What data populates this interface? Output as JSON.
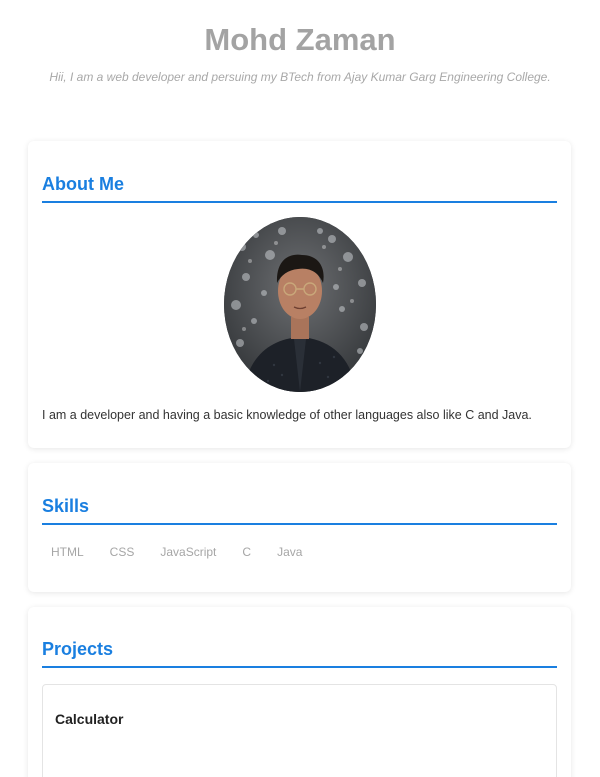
{
  "header": {
    "name": "Mohd Zaman",
    "tagline": "Hii, I am a web developer and persuing my BTech from Ajay Kumar Garg Engineering College."
  },
  "about": {
    "title": "About Me",
    "photo_icon": "profile-photo",
    "text": "I am a developer and having a basic knowledge of other languages also like C and Java."
  },
  "skills": {
    "title": "Skills",
    "items": [
      "HTML",
      "CSS",
      "JavaScript",
      "C",
      "Java"
    ]
  },
  "projects": {
    "title": "Projects",
    "items": [
      {
        "name": "Calculator"
      }
    ]
  },
  "colors": {
    "accent": "#1a7fe0",
    "name_gray": "#a3a3a3",
    "muted": "#a6a6a6"
  }
}
